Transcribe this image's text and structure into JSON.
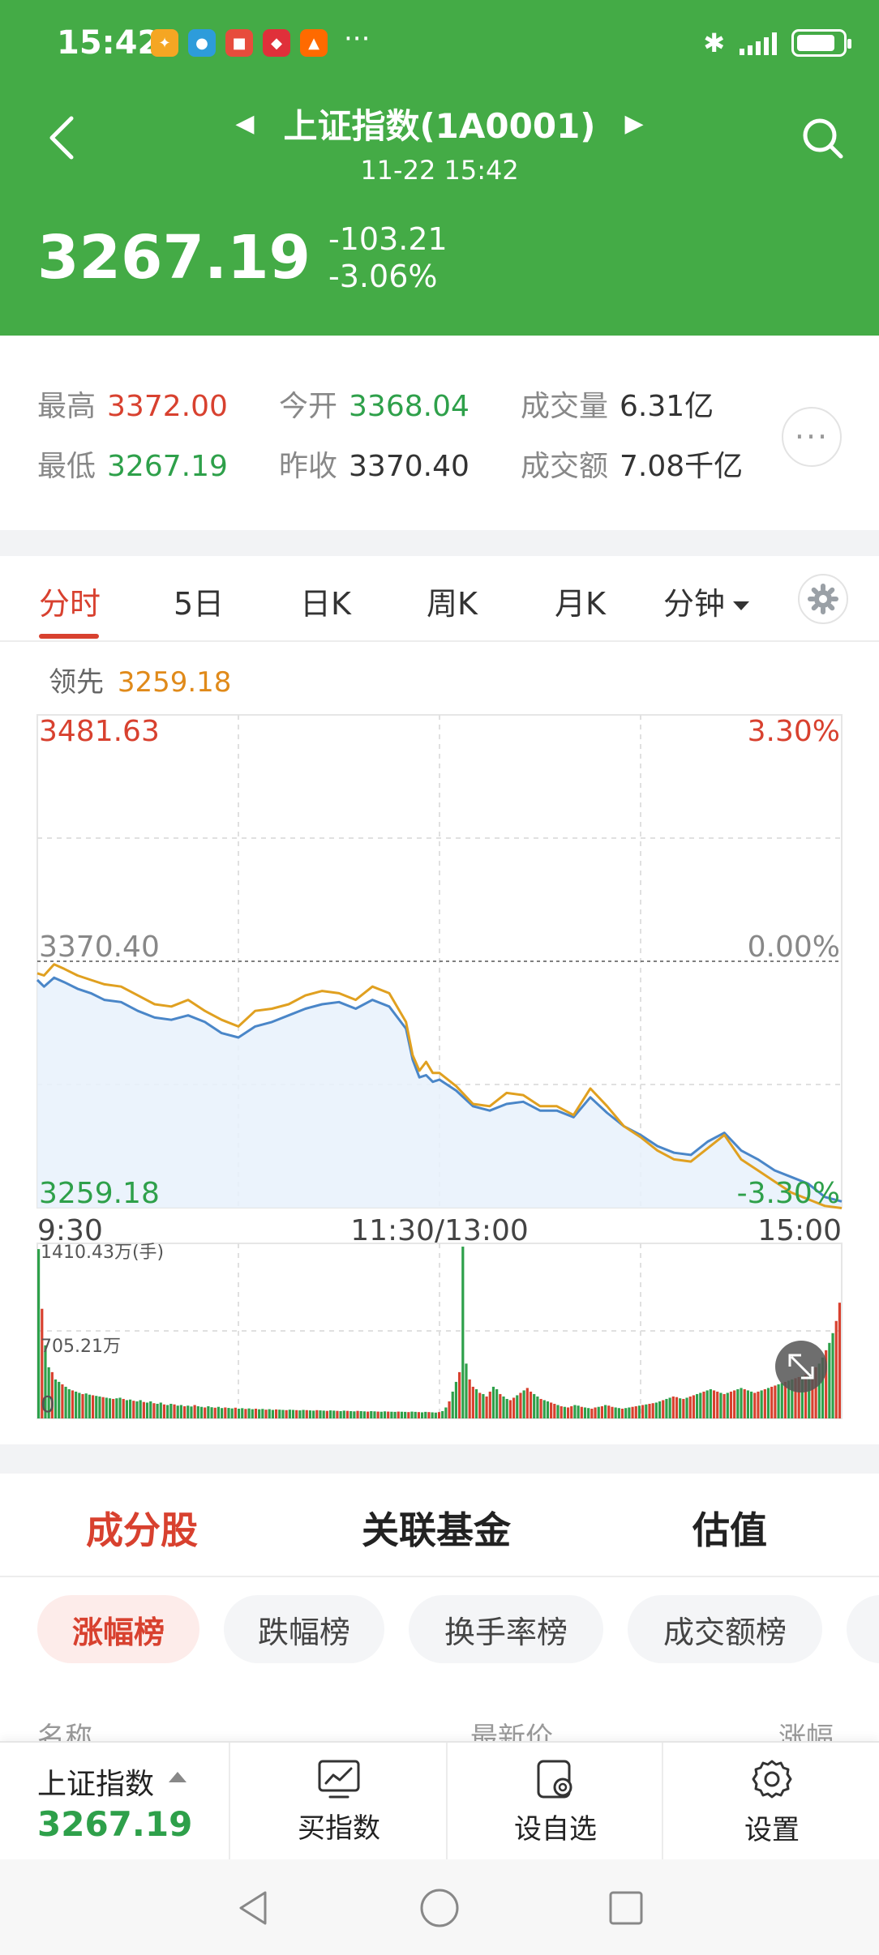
{
  "status_bar": {
    "time": "15:42",
    "more": "···",
    "battery_percent": 85
  },
  "header": {
    "title": "上证指数(1A0001)",
    "subtitle": "11-22 15:42",
    "price": "3267.19",
    "change": "-103.21",
    "change_pct": "-3.06%",
    "color": "#44ab46"
  },
  "stats": [
    {
      "label": "最高",
      "value": "3372.00",
      "color": "#d8412f"
    },
    {
      "label": "今开",
      "value": "3368.04",
      "color": "#2ea04a"
    },
    {
      "label": "成交量",
      "value": "6.31亿",
      "color": "#333333"
    },
    {
      "label": "最低",
      "value": "3267.19",
      "color": "#2ea04a"
    },
    {
      "label": "昨收",
      "value": "3370.40",
      "color": "#333333"
    },
    {
      "label": "成交额",
      "value": "7.08千亿",
      "color": "#333333"
    }
  ],
  "chart_tabs": [
    "分时",
    "5日",
    "日K",
    "周K",
    "月K",
    "分钟"
  ],
  "lead": {
    "label": "领先",
    "value": "3259.18"
  },
  "chart_data": {
    "type": "line",
    "y_left_labels": [
      "3481.63",
      "3370.40",
      "3259.18"
    ],
    "y_right_labels": [
      "3.30%",
      "0.00%",
      "-3.30%"
    ],
    "x_labels": [
      "9:30",
      "11:30/13:00",
      "15:00"
    ],
    "ylim": [
      3259.18,
      3481.63
    ],
    "prev_close": 3370.4,
    "series": [
      {
        "color": "#4a86c8",
        "x": [
          0,
          2,
          5,
          8,
          12,
          16,
          20,
          25,
          30,
          35,
          40,
          45,
          50,
          55,
          60,
          65,
          70,
          75,
          80,
          85,
          90,
          95,
          100,
          105,
          110,
          112,
          114,
          116,
          118,
          120,
          125,
          130,
          135,
          140,
          145,
          150,
          155,
          160,
          165,
          170,
          175,
          180,
          185,
          190,
          195,
          200,
          205,
          210,
          215,
          220,
          225,
          230,
          235,
          240
        ],
        "y": [
          3362,
          3359,
          3363,
          3361,
          3358,
          3356,
          3353,
          3352,
          3348,
          3345,
          3344,
          3346,
          3343,
          3338,
          3336,
          3341,
          3343,
          3346,
          3349,
          3351,
          3352,
          3349,
          3353,
          3350,
          3340,
          3326,
          3318,
          3319,
          3316,
          3317,
          3312,
          3305,
          3303,
          3306,
          3307,
          3303,
          3303,
          3300,
          3309,
          3302,
          3296,
          3292,
          3287,
          3284,
          3283,
          3289,
          3293,
          3285,
          3281,
          3276,
          3273,
          3270,
          3264,
          3262
        ]
      },
      {
        "color": "#e0a020",
        "x": [
          0,
          2,
          5,
          8,
          12,
          16,
          20,
          25,
          30,
          35,
          40,
          45,
          50,
          55,
          60,
          65,
          70,
          75,
          80,
          85,
          90,
          95,
          100,
          105,
          110,
          112,
          114,
          116,
          118,
          120,
          125,
          130,
          135,
          140,
          145,
          150,
          155,
          160,
          165,
          170,
          175,
          180,
          185,
          190,
          195,
          200,
          205,
          210,
          215,
          220,
          225,
          230,
          235,
          240
        ],
        "y": [
          3365,
          3364,
          3369,
          3367,
          3364,
          3362,
          3360,
          3359,
          3355,
          3351,
          3350,
          3353,
          3348,
          3344,
          3341,
          3348,
          3349,
          3351,
          3355,
          3357,
          3356,
          3353,
          3359,
          3356,
          3343,
          3328,
          3321,
          3325,
          3320,
          3320,
          3314,
          3306,
          3305,
          3311,
          3310,
          3305,
          3305,
          3301,
          3313,
          3305,
          3296,
          3291,
          3285,
          3281,
          3280,
          3286,
          3292,
          3281,
          3276,
          3271,
          3266,
          3263,
          3260,
          3259
        ]
      }
    ],
    "volume": {
      "labels": [
        "1410.43万(手)",
        "705.21万",
        "0"
      ],
      "ylim": [
        0,
        1410.43
      ],
      "values": [
        1390,
        900,
        600,
        420,
        380,
        320,
        300,
        280,
        260,
        240,
        230,
        220,
        210,
        200,
        205,
        195,
        190,
        185,
        180,
        175,
        170,
        165,
        160,
        165,
        170,
        160,
        150,
        155,
        145,
        140,
        150,
        135,
        130,
        140,
        125,
        120,
        130,
        115,
        110,
        120,
        115,
        105,
        110,
        100,
        105,
        98,
        110,
        100,
        95,
        90,
        100,
        92,
        88,
        95,
        85,
        90,
        86,
        82,
        88,
        80,
        84,
        78,
        82,
        76,
        80,
        75,
        78,
        72,
        76,
        70,
        74,
        72,
        70,
        68,
        72,
        70,
        68,
        66,
        70,
        68,
        66,
        64,
        68,
        66,
        64,
        62,
        66,
        64,
        62,
        60,
        64,
        62,
        60,
        58,
        62,
        60,
        58,
        56,
        60,
        58,
        56,
        55,
        58,
        56,
        55,
        54,
        56,
        55,
        54,
        52,
        56,
        54,
        52,
        50,
        54,
        52,
        50,
        48,
        52,
        60,
        90,
        140,
        220,
        300,
        380,
        1410,
        450,
        320,
        260,
        240,
        210,
        200,
        180,
        220,
        260,
        240,
        200,
        180,
        160,
        150,
        170,
        190,
        210,
        230,
        250,
        220,
        200,
        180,
        160,
        150,
        140,
        130,
        120,
        110,
        100,
        95,
        90,
        100,
        110,
        105,
        95,
        90,
        85,
        80,
        90,
        95,
        100,
        110,
        105,
        95,
        90,
        85,
        80,
        85,
        90,
        95,
        100,
        105,
        110,
        115,
        120,
        125,
        130,
        140,
        150,
        160,
        170,
        180,
        175,
        165,
        160,
        170,
        180,
        190,
        200,
        210,
        220,
        230,
        240,
        230,
        220,
        210,
        200,
        210,
        220,
        230,
        240,
        250,
        240,
        230,
        220,
        210,
        220,
        230,
        240,
        250,
        260,
        270,
        280,
        290,
        300,
        310,
        320,
        330,
        340,
        350,
        360,
        380,
        400,
        420,
        450,
        500,
        560,
        620,
        700,
        800,
        950
      ]
    }
  },
  "sub_tabs": [
    "成分股",
    "关联基金",
    "估值"
  ],
  "chips": [
    "涨幅榜",
    "跌幅榜",
    "换手率榜",
    "成交额榜"
  ],
  "list_headers": [
    "名称",
    "最新价",
    "涨幅"
  ],
  "bottom_bar": {
    "index_name": "上证指数",
    "index_price": "3267.19",
    "buy_label": "买指数",
    "watch_label": "设自选",
    "settings_label": "设置"
  },
  "colors": {
    "up": "#d8412f",
    "down": "#2ea04a",
    "accent": "#d8412f",
    "lead": "#e08a1a"
  }
}
